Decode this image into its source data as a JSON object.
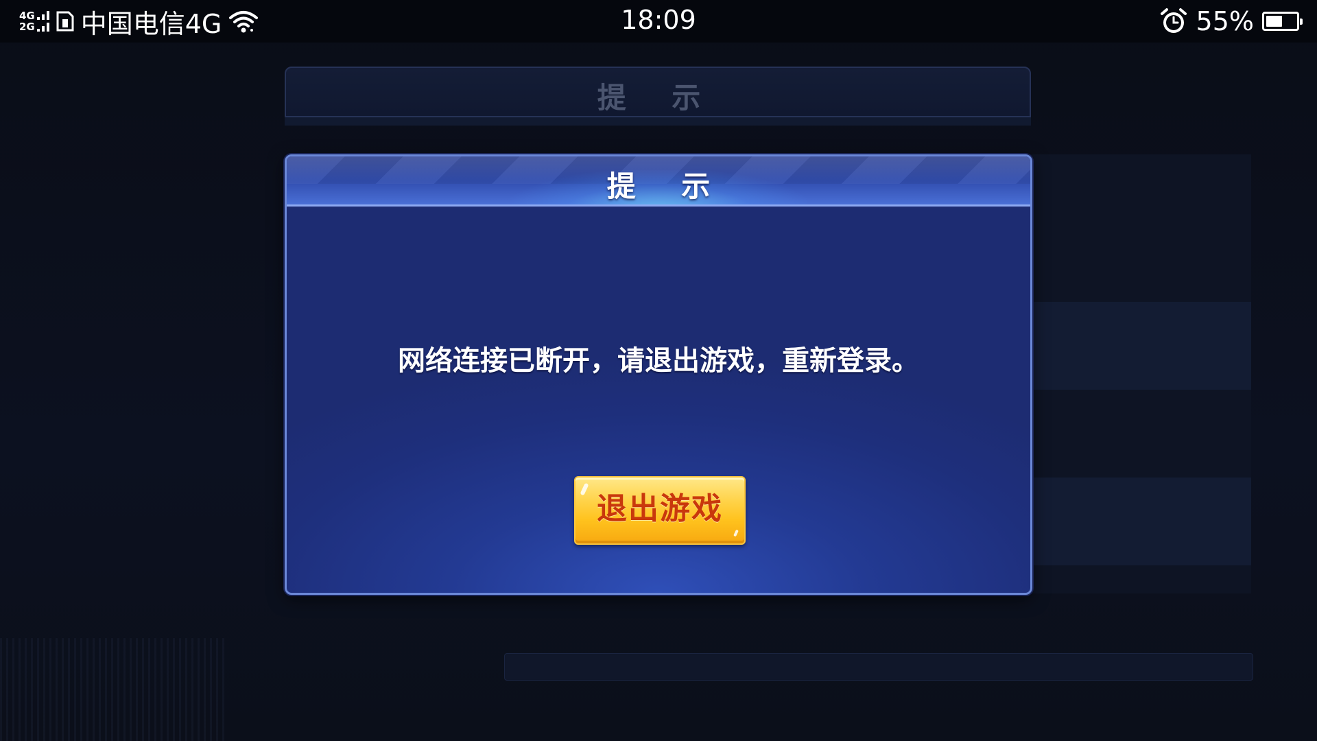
{
  "status_bar": {
    "network_top": "4G",
    "network_bottom": "2G",
    "carrier": "中国电信4G",
    "time": "18:09",
    "battery_percent": "55%",
    "battery_level": 0.55,
    "icons": [
      "signal-icon",
      "sim-card-icon",
      "wifi-icon",
      "alarm-clock-icon",
      "battery-icon"
    ]
  },
  "background_dialog": {
    "title": "提 示"
  },
  "dialog": {
    "title": "提 示",
    "message": "网络连接已断开，请退出游戏，重新登录。",
    "exit_button_label": "退出游戏"
  },
  "colors": {
    "dialog_bg": "#1e2f7c",
    "dialog_border": "#6b88d8",
    "button_gold": "#ffc21d",
    "button_text": "#c9380c"
  }
}
